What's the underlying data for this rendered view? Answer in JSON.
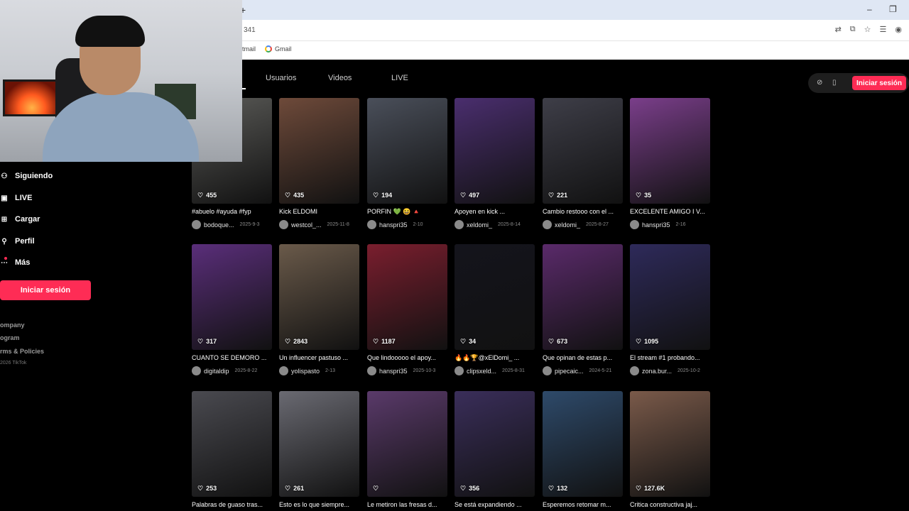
{
  "browser": {
    "new_tab": "+",
    "minimize": "–",
    "restore": "❐",
    "address_fragment": "341",
    "bookmarks": [
      {
        "label": "tmail"
      },
      {
        "label": "Gmail"
      }
    ]
  },
  "nav": {
    "tabs": [
      "Usuarios",
      "Videos",
      "LIVE"
    ],
    "login_top": "Iniciar sesión"
  },
  "sidebar": {
    "items": [
      {
        "label": "Siguiendo",
        "icon": "⚇"
      },
      {
        "label": "LIVE",
        "icon": "▣"
      },
      {
        "label": "Cargar",
        "icon": "⊞"
      },
      {
        "label": "Perfil",
        "icon": "⚲"
      },
      {
        "label": "Más",
        "icon": "⋯"
      }
    ],
    "login": "Iniciar sesión",
    "footer": [
      "ompany",
      "ogram",
      "rms & Policies"
    ],
    "copyright": "2026 TikTok"
  },
  "videos": [
    {
      "likes": "455",
      "caption": "#abuelo #ayuda #fyp",
      "author": "bodoque...",
      "date": "2025-9-3",
      "bg": "#5b5b58"
    },
    {
      "likes": "435",
      "caption": "Kick ELDOMI",
      "author": "westcol_...",
      "date": "2025-11-8",
      "bg": "#6e4a3a"
    },
    {
      "likes": "194",
      "caption": "PORFIN 💚 😆 🔺",
      "author": "hanspri35",
      "date": "2-10",
      "bg": "#4a4f5a"
    },
    {
      "likes": "497",
      "caption": "Apoyen en kick ...",
      "author": "xeldomi_",
      "date": "2025-8-14",
      "bg": "#4a2e6e"
    },
    {
      "likes": "221",
      "caption": "Cambio restooo con el ...",
      "author": "xeldomi_",
      "date": "2025-8-27",
      "bg": "#3e3e48"
    },
    {
      "likes": "35",
      "caption": "EXCELENTE AMIGO I V...",
      "author": "hanspri35",
      "date": "2-16",
      "bg": "#7a3e8a"
    },
    {
      "likes": "317",
      "caption": "CUANTO SE DEMORO ...",
      "author": "digitaldip",
      "date": "2025-8-22",
      "bg": "#5a2e7a"
    },
    {
      "likes": "2843",
      "caption": "Un influencer pastuso ...",
      "author": "yolispasto",
      "date": "2-13",
      "bg": "#6a5a4a"
    },
    {
      "likes": "1187",
      "caption": "Que lindooooo el apoy...",
      "author": "hanspri35",
      "date": "2025-10-3",
      "bg": "#7a1e2e"
    },
    {
      "likes": "34",
      "caption": "🔥🔥🏆@xElDomi_ ...",
      "author": "clipsxeld...",
      "date": "2025-8-31",
      "bg": "#14141c"
    },
    {
      "likes": "673",
      "caption": "Que opinan de estas p...",
      "author": "pipecaic...",
      "date": "2024-5-21",
      "bg": "#5a2a6a"
    },
    {
      "likes": "1095",
      "caption": "El stream #1 probando...",
      "author": "zona.bur...",
      "date": "2025-10-2",
      "bg": "#2e2a5a"
    },
    {
      "likes": "253",
      "caption": "Palabras de guaso tras...",
      "author": "",
      "date": "",
      "bg": "#4a4a50"
    },
    {
      "likes": "261",
      "caption": "Esto es lo que siempre...",
      "author": "",
      "date": "",
      "bg": "#6a6a72"
    },
    {
      "likes": "",
      "caption": "Le metiron las fresas d...",
      "author": "",
      "date": "",
      "bg": "#5a3a6a"
    },
    {
      "likes": "356",
      "caption": "Se está expandiendo ...",
      "author": "",
      "date": "",
      "bg": "#3a2e5a"
    },
    {
      "likes": "132",
      "caption": "Esperemos retomar m...",
      "author": "",
      "date": "",
      "bg": "#2e4a6a"
    },
    {
      "likes": "127.6K",
      "caption": "Critica constructiva jaj...",
      "author": "",
      "date": "",
      "bg": "#7a5a4a"
    }
  ],
  "colors": {
    "accent": "#fe2c55",
    "background": "#000000"
  }
}
